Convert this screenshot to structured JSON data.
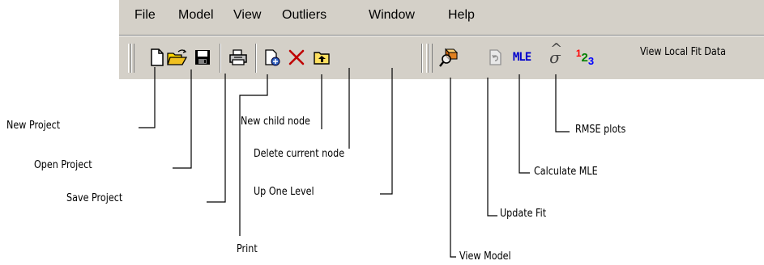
{
  "menu": {
    "items": [
      "File",
      "Model",
      "View",
      "Outliers",
      "Window",
      "Help"
    ]
  },
  "toolbar": {
    "buttons": [
      {
        "icon": "new-project-icon"
      },
      {
        "icon": "open-project-icon"
      },
      {
        "icon": "save-project-icon"
      },
      {
        "icon": "print-icon"
      },
      {
        "icon": "new-child-node-icon"
      },
      {
        "icon": "delete-node-icon"
      },
      {
        "icon": "up-one-level-icon"
      },
      {
        "icon": "view-model-icon"
      },
      {
        "icon": "update-fit-icon"
      },
      {
        "icon": "calculate-mle-icon",
        "text": "MLE"
      },
      {
        "icon": "rmse-plots-icon",
        "text": "σ̂"
      },
      {
        "icon": "view-local-fit-data-icon",
        "text": "123"
      }
    ]
  },
  "callouts": {
    "new_project": "New Project",
    "open_project": "Open Project",
    "save_project": "Save Project",
    "print": "Print",
    "new_child_node": "New child node",
    "delete_current_node": "Delete current node",
    "up_one_level": "Up One Level",
    "view_model": "View Model",
    "update_fit": "Update Fit",
    "calculate_mle": "Calculate MLE",
    "rmse_plots": "RMSE plots",
    "view_local_fit_data": "View Local Fit Data"
  },
  "colors": {
    "panel": "#d4d0c8",
    "mle_blue": "#0000cc",
    "delete_red": "#c00000",
    "number_1": "#ff0000",
    "number_2": "#008000",
    "number_3": "#0000ff"
  }
}
